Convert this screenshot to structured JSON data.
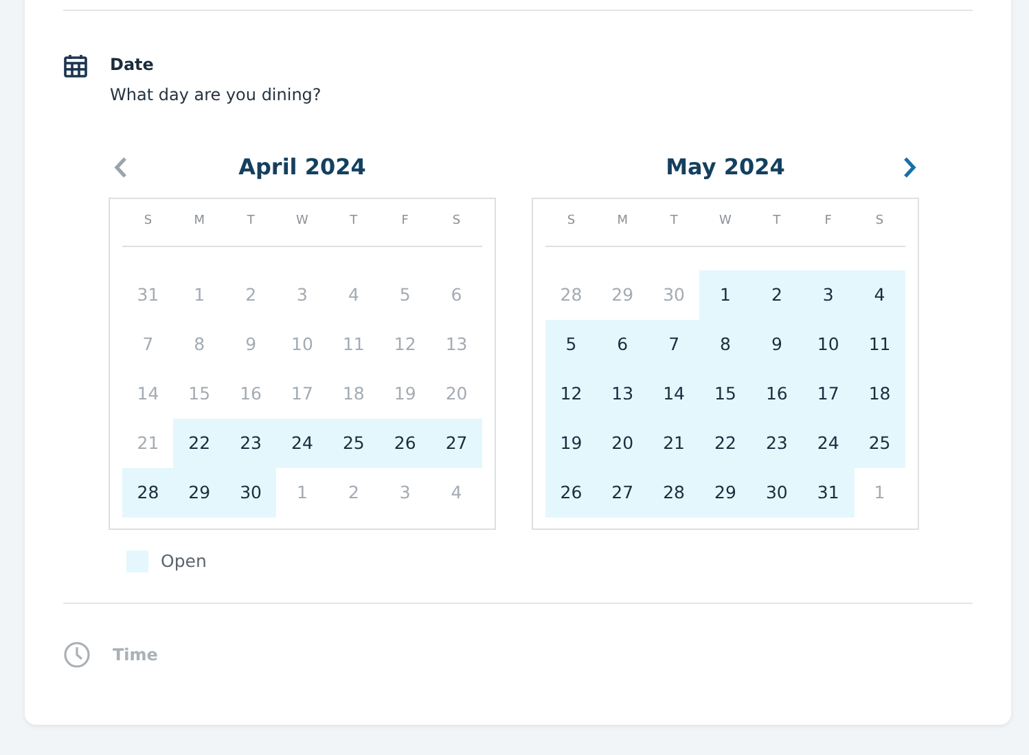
{
  "date_section": {
    "title": "Date",
    "subtitle": "What day are you dining?"
  },
  "nav": {
    "prev": {
      "disabled": true
    },
    "next": {
      "disabled": false
    }
  },
  "months": [
    {
      "title": "April 2024",
      "weekdays": [
        "S",
        "M",
        "T",
        "W",
        "T",
        "F",
        "S"
      ],
      "weeks": [
        [
          {
            "day": "31",
            "open": false
          },
          {
            "day": "1",
            "open": false
          },
          {
            "day": "2",
            "open": false
          },
          {
            "day": "3",
            "open": false
          },
          {
            "day": "4",
            "open": false
          },
          {
            "day": "5",
            "open": false
          },
          {
            "day": "6",
            "open": false
          }
        ],
        [
          {
            "day": "7",
            "open": false
          },
          {
            "day": "8",
            "open": false
          },
          {
            "day": "9",
            "open": false
          },
          {
            "day": "10",
            "open": false
          },
          {
            "day": "11",
            "open": false
          },
          {
            "day": "12",
            "open": false
          },
          {
            "day": "13",
            "open": false
          }
        ],
        [
          {
            "day": "14",
            "open": false
          },
          {
            "day": "15",
            "open": false
          },
          {
            "day": "16",
            "open": false
          },
          {
            "day": "17",
            "open": false
          },
          {
            "day": "18",
            "open": false
          },
          {
            "day": "19",
            "open": false
          },
          {
            "day": "20",
            "open": false
          }
        ],
        [
          {
            "day": "21",
            "open": false
          },
          {
            "day": "22",
            "open": true
          },
          {
            "day": "23",
            "open": true
          },
          {
            "day": "24",
            "open": true
          },
          {
            "day": "25",
            "open": true
          },
          {
            "day": "26",
            "open": true
          },
          {
            "day": "27",
            "open": true
          }
        ],
        [
          {
            "day": "28",
            "open": true
          },
          {
            "day": "29",
            "open": true
          },
          {
            "day": "30",
            "open": true
          },
          {
            "day": "1",
            "open": false
          },
          {
            "day": "2",
            "open": false
          },
          {
            "day": "3",
            "open": false
          },
          {
            "day": "4",
            "open": false
          }
        ]
      ]
    },
    {
      "title": "May 2024",
      "weekdays": [
        "S",
        "M",
        "T",
        "W",
        "T",
        "F",
        "S"
      ],
      "weeks": [
        [
          {
            "day": "28",
            "open": false
          },
          {
            "day": "29",
            "open": false
          },
          {
            "day": "30",
            "open": false
          },
          {
            "day": "1",
            "open": true
          },
          {
            "day": "2",
            "open": true
          },
          {
            "day": "3",
            "open": true
          },
          {
            "day": "4",
            "open": true
          }
        ],
        [
          {
            "day": "5",
            "open": true
          },
          {
            "day": "6",
            "open": true
          },
          {
            "day": "7",
            "open": true
          },
          {
            "day": "8",
            "open": true
          },
          {
            "day": "9",
            "open": true
          },
          {
            "day": "10",
            "open": true
          },
          {
            "day": "11",
            "open": true
          }
        ],
        [
          {
            "day": "12",
            "open": true
          },
          {
            "day": "13",
            "open": true
          },
          {
            "day": "14",
            "open": true
          },
          {
            "day": "15",
            "open": true
          },
          {
            "day": "16",
            "open": true
          },
          {
            "day": "17",
            "open": true
          },
          {
            "day": "18",
            "open": true
          }
        ],
        [
          {
            "day": "19",
            "open": true
          },
          {
            "day": "20",
            "open": true
          },
          {
            "day": "21",
            "open": true
          },
          {
            "day": "22",
            "open": true
          },
          {
            "day": "23",
            "open": true
          },
          {
            "day": "24",
            "open": true
          },
          {
            "day": "25",
            "open": true
          }
        ],
        [
          {
            "day": "26",
            "open": true
          },
          {
            "day": "27",
            "open": true
          },
          {
            "day": "28",
            "open": true
          },
          {
            "day": "29",
            "open": true
          },
          {
            "day": "30",
            "open": true
          },
          {
            "day": "31",
            "open": true
          },
          {
            "day": "1",
            "open": false
          }
        ]
      ]
    }
  ],
  "legend": {
    "label": "Open"
  },
  "time_section": {
    "title": "Time",
    "disabled": true
  }
}
